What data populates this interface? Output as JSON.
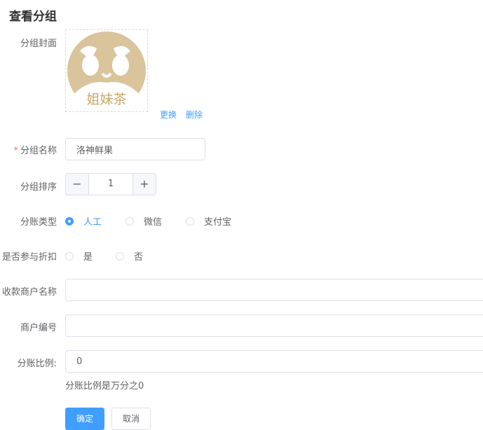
{
  "page": {
    "title": "查看分组"
  },
  "cover": {
    "label": "分组封面",
    "logo_text": "姐妹茶",
    "replace_label": "更换",
    "delete_label": "删除",
    "accent": "#d9c49b"
  },
  "name": {
    "required_mark": "*",
    "label": "分组名称",
    "value": "洛神鲜果"
  },
  "sort": {
    "label": "分组排序",
    "minus": "−",
    "value": "1",
    "plus": "+"
  },
  "split_type": {
    "label": "分账类型",
    "options": [
      {
        "label": "人工",
        "checked": true
      },
      {
        "label": "微信",
        "checked": false
      },
      {
        "label": "支付宝",
        "checked": false
      }
    ]
  },
  "discount": {
    "label": "是否参与折扣",
    "options": [
      {
        "label": "是",
        "checked": false
      },
      {
        "label": "否",
        "checked": false
      }
    ]
  },
  "payee_name": {
    "label": "收款商户名称",
    "value": ""
  },
  "merchant_no": {
    "label": "商户编号",
    "value": ""
  },
  "ratio": {
    "label": "分账比例:",
    "value": "0",
    "hint": "分账比例是万分之0"
  },
  "actions": {
    "confirm": "确定",
    "cancel": "取消"
  },
  "colors": {
    "primary": "#409eff",
    "required": "#f56c6c",
    "border": "#dcdfe6"
  }
}
